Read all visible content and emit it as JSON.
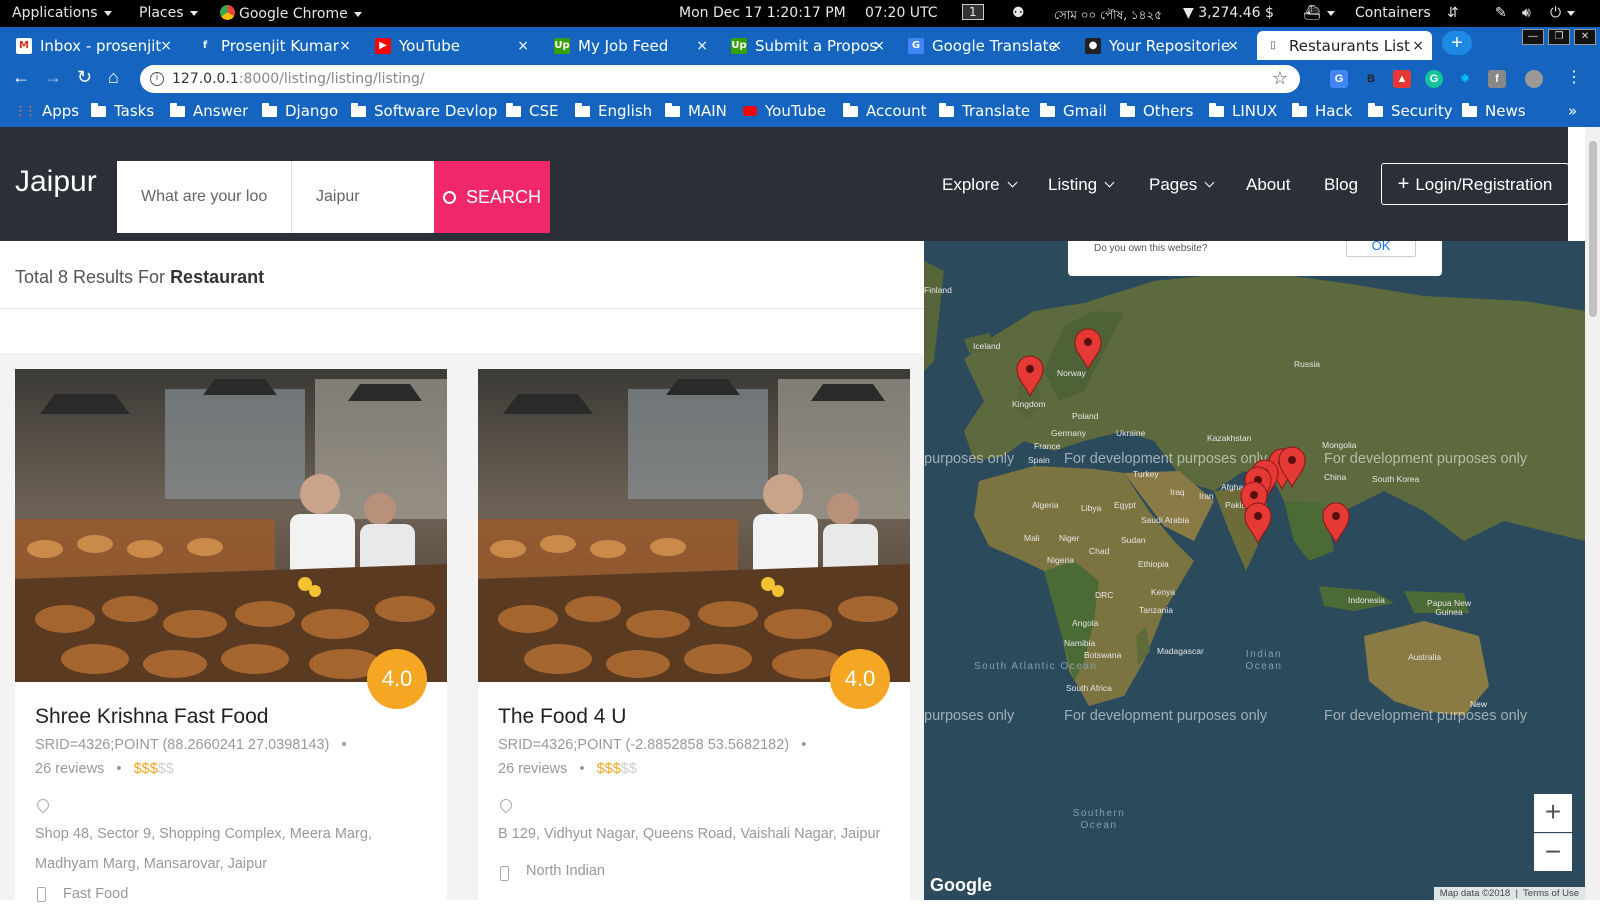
{
  "system_bar": {
    "applications": "Applications",
    "places": "Places",
    "active_app": "Google Chrome",
    "date_time": "Mon Dec 17  1:20:17 PM",
    "utc_time": "07:20 UTC",
    "workspace": "1",
    "bengali_date": "সোম ০০ পৌষ, ১৪২৫",
    "crypto": "▼ 3,274.46 $",
    "containers": "Containers"
  },
  "tabs": [
    {
      "title": "Inbox - prosenjit",
      "icon": "gmail-icon",
      "color": "#ffffff",
      "glyph": "M",
      "glyph_color": "#d93025"
    },
    {
      "title": "Prosenjit Kumar",
      "icon": "facebook-icon",
      "color": "#1565c0",
      "glyph": "f",
      "glyph_color": "#ffffff"
    },
    {
      "title": "YouTube",
      "icon": "youtube-icon",
      "color": "#ff0000",
      "glyph": "▶",
      "glyph_color": "#ffffff"
    },
    {
      "title": "My Job Feed",
      "icon": "upwork-icon",
      "color": "#37a000",
      "glyph": "Up",
      "glyph_color": "#ffffff"
    },
    {
      "title": "Submit a Propos",
      "icon": "upwork-icon",
      "color": "#37a000",
      "glyph": "Up",
      "glyph_color": "#ffffff"
    },
    {
      "title": "Google Translate",
      "icon": "translate-icon",
      "color": "#4285f4",
      "glyph": "G",
      "glyph_color": "#ffffff"
    },
    {
      "title": "Your Repositorie",
      "icon": "github-icon",
      "color": "#222222",
      "glyph": "●",
      "glyph_color": "#ffffff"
    },
    {
      "title": "Restaurants List",
      "icon": "page-icon",
      "color": "#ffffff",
      "glyph": "▯",
      "glyph_color": "#555555"
    }
  ],
  "address": {
    "host": "127.0.0.1",
    "path": ":8000/listing/listing/listing/"
  },
  "bookmarks": [
    "Apps",
    "Tasks",
    "Answer",
    "Django",
    "Software Devlop",
    "CSE",
    "English",
    "MAIN",
    "YouTube",
    "Account",
    "Translate",
    "Gmail",
    "Others",
    "LINUX",
    "Hack",
    "Security",
    "News"
  ],
  "header": {
    "logo": "Jaipur",
    "search_placeholder": "What are your loo",
    "location": "Jaipur",
    "search_button": "SEARCH",
    "nav": [
      "Explore",
      "Listing",
      "Pages",
      "About",
      "Blog"
    ],
    "login": "Login/Registration"
  },
  "results": {
    "prefix": "Total 8 Results For ",
    "term": "Restaurant"
  },
  "listings": [
    {
      "rating": "4.0",
      "name": "Shree Krishna Fast Food",
      "location": "SRID=4326;POINT (88.2660241 27.0398143)",
      "reviews": "26 reviews",
      "price_on": "$$$",
      "price_off": "$$",
      "address_line1": "Shop 48, Sector 9, Shopping Complex, Meera Marg,",
      "address_line2": "Madhyam Marg, Mansarovar, Jaipur",
      "cuisine": "Fast Food"
    },
    {
      "rating": "4.0",
      "name": "The Food 4 U",
      "location": "SRID=4326;POINT (-2.8852858 53.5682182)",
      "reviews": "26 reviews",
      "price_on": "$$$",
      "price_off": "$$",
      "address_line1": "B 129, Vidhyut Nagar, Queens Road, Vaishali Nagar, Jaipur",
      "address_line2": "",
      "cuisine": "North Indian"
    }
  ],
  "map": {
    "dialog_text": "Do you own this website?",
    "dialog_ok": "OK",
    "watermark": "For development purposes only",
    "watermark_partial": "purposes only",
    "countries": [
      "Finland",
      "Iceland",
      "Norway",
      "Russia",
      "Kingdom",
      "Poland",
      "Germany",
      "Ukraine",
      "Kazakhstan",
      "Mongolia",
      "France",
      "Spain",
      "Turkey",
      "China",
      "Afghanistan",
      "South Korea",
      "Iraq",
      "Iran",
      "Pakistan",
      "Algeria",
      "Libya",
      "Egypt",
      "Saudi Arabia",
      "Mali",
      "Niger",
      "Chad",
      "Sudan",
      "Nigeria",
      "Ethiopia",
      "Kenya",
      "DRC",
      "Tanzania",
      "Indonesia",
      "Papua New Guinea",
      "Angola",
      "Namibia",
      "Botswana",
      "Madagascar",
      "South Africa",
      "Australia",
      "New"
    ],
    "oceans": [
      "South Atlantic Ocean",
      "Indian Ocean",
      "Southern Ocean"
    ],
    "zoom_in": "+",
    "zoom_out": "−",
    "google": "Google",
    "map_data": "Map data ©2018",
    "terms": "Terms of Use",
    "pin_color": "#e53935"
  }
}
